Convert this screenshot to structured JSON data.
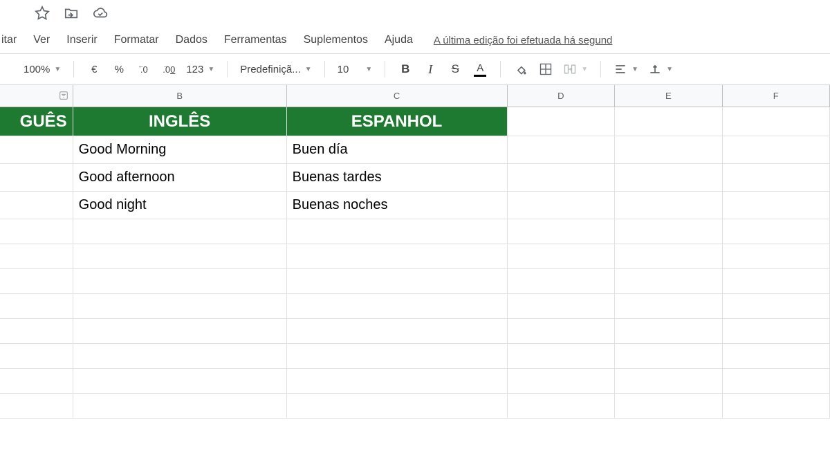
{
  "titlebar": {
    "star_icon": "star",
    "move_icon": "move-to-folder",
    "cloud_icon": "cloud-saved"
  },
  "menu": {
    "editar": "itar",
    "ver": "Ver",
    "inserir": "Inserir",
    "formatar": "Formatar",
    "dados": "Dados",
    "ferramentas": "Ferramentas",
    "suplementos": "Suplementos",
    "ajuda": "Ajuda",
    "edit_status": "A última edição foi efetuada há segund"
  },
  "toolbar": {
    "zoom": "100%",
    "currency": "€",
    "percent": "%",
    "dec_dec": ".0",
    "inc_dec": ".00",
    "format123": "123",
    "font": "Predefiniçã...",
    "fontsize": "10",
    "bold": "B",
    "italic": "I",
    "strike": "S",
    "text_a": "A"
  },
  "columns": {
    "a": "",
    "b": "B",
    "c": "C",
    "d": "D",
    "e": "E",
    "f": "F"
  },
  "table": {
    "headers": {
      "a": "GUÊS",
      "b": "INGLÊS",
      "c": "ESPANHOL"
    },
    "rows": [
      {
        "b": "Good Morning",
        "c": "Buen día"
      },
      {
        "b": "Good afternoon",
        "c": "Buenas tardes"
      },
      {
        "b": "Good night",
        "c": "Buenas noches"
      }
    ]
  }
}
